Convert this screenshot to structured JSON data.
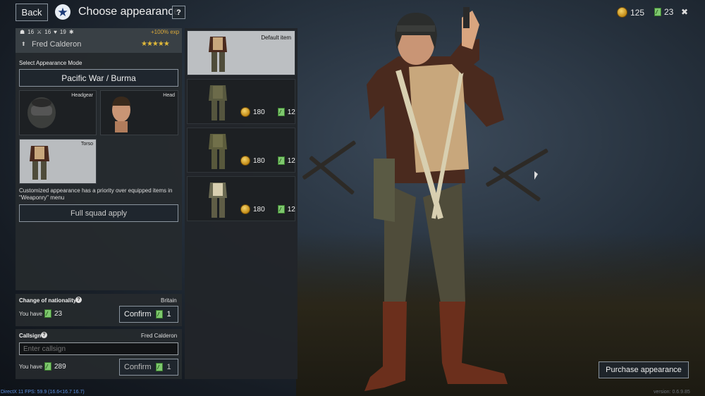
{
  "header": {
    "back_label": "Back",
    "title": "Choose appearance",
    "help_label": "?",
    "gold": "125",
    "tickets": "23",
    "close_label": "✖"
  },
  "soldier": {
    "stat_1": "16",
    "stat_2": "16",
    "stat_3": "19",
    "exp_bonus": "+100% exp",
    "name": "Fred Calderon",
    "stars": "★★★★★"
  },
  "appearance": {
    "mode_label": "Select Appearance Mode",
    "mode_value": "Pacific War / Burma",
    "slots": [
      "Headgear",
      "Head",
      "Torso"
    ],
    "note": "Customized appearance has a priority over equipped items in \"Weaponry\" menu",
    "squad_apply_label": "Full squad apply"
  },
  "nationality": {
    "label": "Change of nationality",
    "value": "Britain",
    "you_have_label": "You have",
    "amount": "23",
    "confirm_label": "Confirm",
    "cost": "1"
  },
  "callsign": {
    "label": "Callsign",
    "value": "Fred Calderon",
    "placeholder": "Enter callsign",
    "you_have_label": "You have",
    "amount": "289",
    "confirm_label": "Confirm",
    "cost": "1"
  },
  "items": [
    {
      "label": "Default item"
    },
    {
      "gold": "180",
      "tickets": "12"
    },
    {
      "gold": "180",
      "tickets": "12"
    },
    {
      "gold": "180",
      "tickets": "12"
    }
  ],
  "purchase_label": "Purchase appearance",
  "footer": {
    "fps": "DirectX 11 FPS: 59.9 (16.6<16.7 16.7)",
    "version": "version: 0.6.9.85"
  }
}
